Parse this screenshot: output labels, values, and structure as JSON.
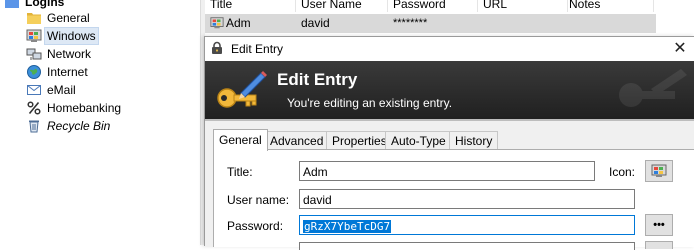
{
  "tree": {
    "items": [
      {
        "label": "Logins",
        "icon": "folder-icon"
      },
      {
        "label": "General",
        "icon": "folder-icon"
      },
      {
        "label": "Windows",
        "icon": "windows-icon",
        "selected": true
      },
      {
        "label": "Network",
        "icon": "network-icon"
      },
      {
        "label": "Internet",
        "icon": "globe-icon"
      },
      {
        "label": "eMail",
        "icon": "email-icon"
      },
      {
        "label": "Homebanking",
        "icon": "percent-icon"
      },
      {
        "label": "Recycle Bin",
        "icon": "recycle-bin-icon"
      }
    ]
  },
  "list": {
    "columns": [
      "Title",
      "User Name",
      "Password",
      "URL",
      "Notes"
    ],
    "rows": [
      {
        "title": "Adm",
        "username": "david",
        "password": "********",
        "url": "",
        "notes": ""
      }
    ]
  },
  "dialog": {
    "window_title": "Edit Entry",
    "close_glyph": "✕",
    "banner_title": "Edit Entry",
    "banner_subtitle": "You're editing an existing entry.",
    "tabs": [
      "General",
      "Advanced",
      "Properties",
      "Auto-Type",
      "History"
    ],
    "active_tab": "General",
    "fields": {
      "title_label": "Title:",
      "title_value": "Adm",
      "icon_label": "Icon:",
      "username_label": "User name:",
      "username_value": "david",
      "password_label": "Password:",
      "password_value": "gRzX7YbeTcDG7",
      "reveal_button": "•••"
    }
  },
  "colors": {
    "selection": "#0078d7",
    "banner_dark": "#202020",
    "list_row_selected": "#d9d9d9"
  }
}
